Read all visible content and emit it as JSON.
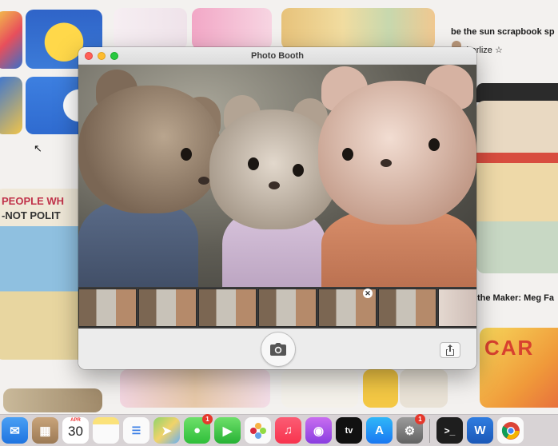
{
  "window": {
    "title": "Photo Booth"
  },
  "background": {
    "pin_title": "be the sun scrapbook sp",
    "pin_user": "charlize ☆",
    "pin_maker": "the Maker: Meg Fa",
    "poster_line1": "PEOPLE WH",
    "poster_line2": "-NOT POLIT",
    "card_text": "CAR"
  },
  "strip": {
    "thumbnail_count": 6
  },
  "dock": {
    "calendar_month": "APR",
    "calendar_day": "30",
    "badges": {
      "messages": "1",
      "appstore": "1"
    },
    "apps": [
      "mail",
      "launchpad",
      "calendar",
      "notes",
      "reminders",
      "maps",
      "messages",
      "facetime",
      "photos",
      "music",
      "podcasts",
      "tv",
      "appstore",
      "system-settings",
      "terminal",
      "word",
      "chrome"
    ]
  },
  "colors": {
    "close": "#ff5f57",
    "minimize": "#febc2e",
    "maximize": "#28c840",
    "badge": "#e5382c"
  }
}
